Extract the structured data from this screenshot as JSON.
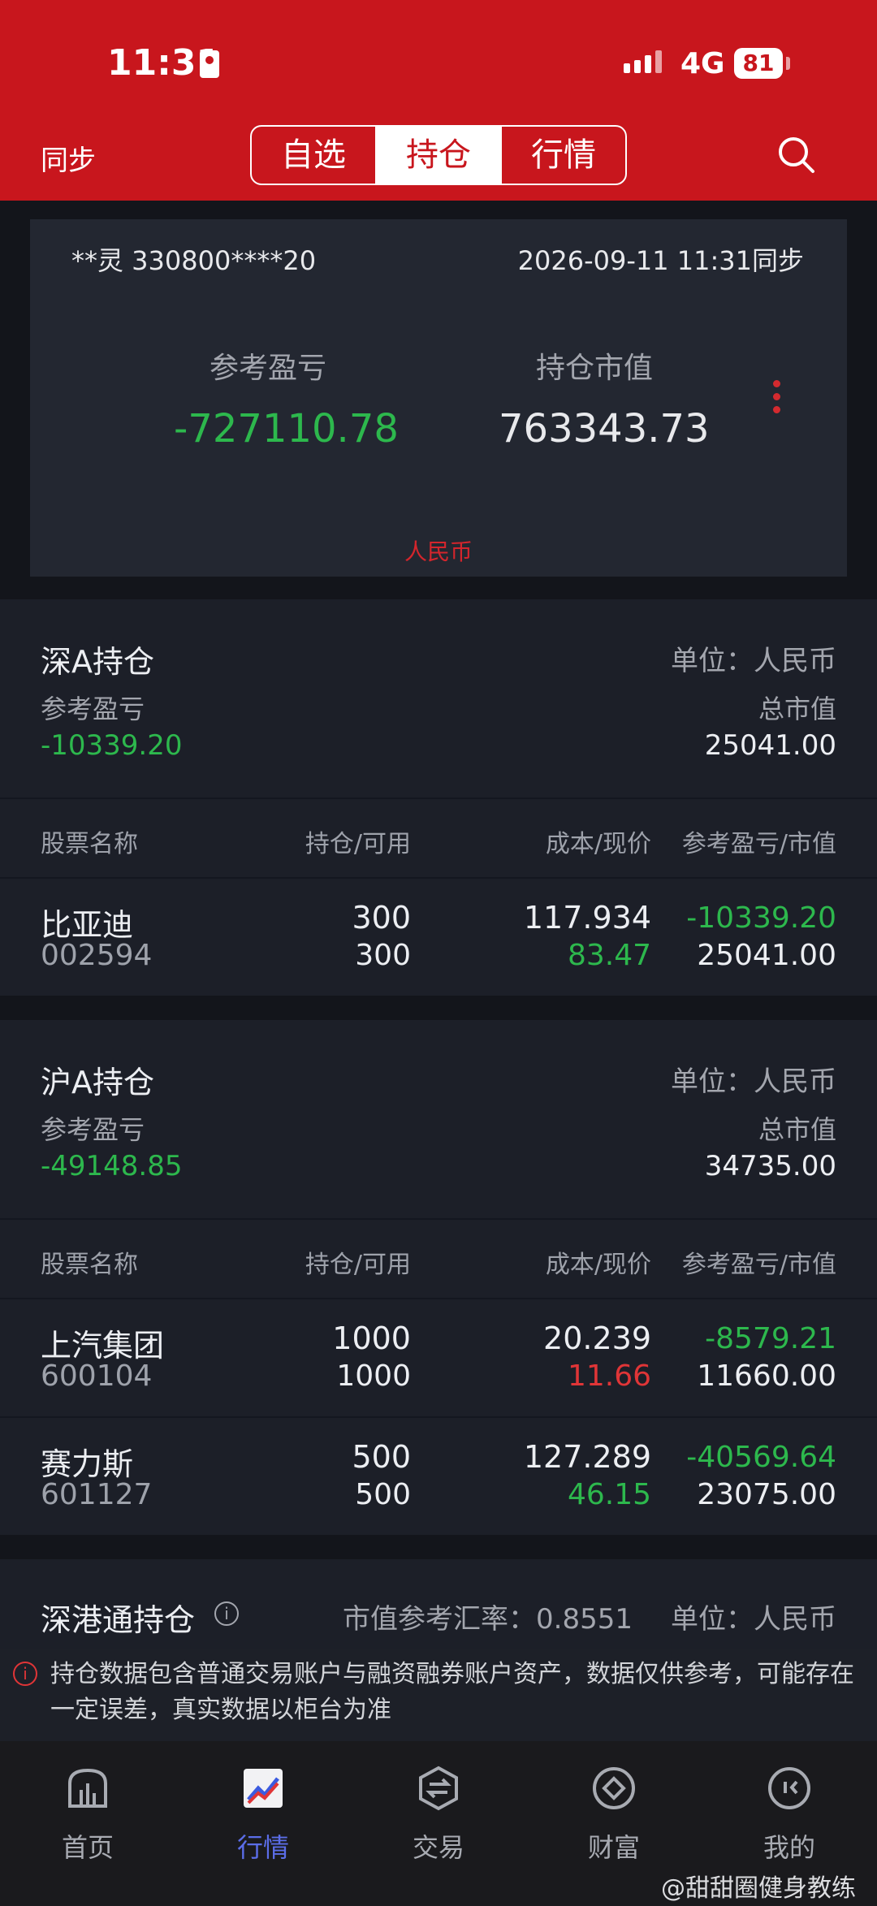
{
  "status_bar": {
    "time": "11:31",
    "network": "4G",
    "battery": "81"
  },
  "header": {
    "sync_label": "同步",
    "tabs": [
      "自选",
      "持仓",
      "行情"
    ],
    "active_tab": "持仓"
  },
  "account": {
    "name_id": "**灵 330800****20",
    "sync_time": "2026-09-11 11:31同步",
    "pl_label": "参考盈亏",
    "pl_value": "-727110.78",
    "mv_label": "持仓市值",
    "mv_value": "763343.73",
    "currency": "人民币"
  },
  "shen_a": {
    "title": "深A持仓",
    "unit": "单位：人民币",
    "pl_label": "参考盈亏",
    "pl_value": "-10339.20",
    "mv_label": "总市值",
    "mv_value": "25041.00",
    "columns": [
      "股票名称",
      "持仓/可用",
      "成本/现价",
      "参考盈亏/市值"
    ],
    "rows": [
      {
        "name": "比亚迪",
        "code": "002594",
        "hold": "300",
        "avail": "300",
        "cost": "117.934",
        "price": "83.47",
        "pl": "-10339.20",
        "mv": "25041.00"
      }
    ]
  },
  "hu_a": {
    "title": "沪A持仓",
    "unit": "单位：人民币",
    "pl_label": "参考盈亏",
    "pl_value": "-49148.85",
    "mv_label": "总市值",
    "mv_value": "34735.00",
    "columns": [
      "股票名称",
      "持仓/可用",
      "成本/现价",
      "参考盈亏/市值"
    ],
    "rows": [
      {
        "name": "上汽集团",
        "code": "600104",
        "hold": "1000",
        "avail": "1000",
        "cost": "20.239",
        "price": "11.66",
        "pl": "-8579.21",
        "mv": "11660.00"
      },
      {
        "name": "赛力斯",
        "code": "601127",
        "hold": "500",
        "avail": "500",
        "cost": "127.289",
        "price": "46.15",
        "pl": "-40569.64",
        "mv": "23075.00"
      }
    ]
  },
  "sgt": {
    "title": "深港通持仓",
    "rate": "市值参考汇率：0.8551",
    "unit": "单位：人民币"
  },
  "notice": "持仓数据包含普通交易账户与融资融券账户资产，数据仅供参考，可能存在一定误差，真实数据以柜台为准",
  "nav": [
    "首页",
    "行情",
    "交易",
    "财富",
    "我的"
  ],
  "watermark": "@甜甜圈健身教练",
  "colors": {
    "brand_red": "#c8161d",
    "loss_green": "#2db84d",
    "up_red": "#e03537",
    "active_blue": "#5b6de8"
  }
}
